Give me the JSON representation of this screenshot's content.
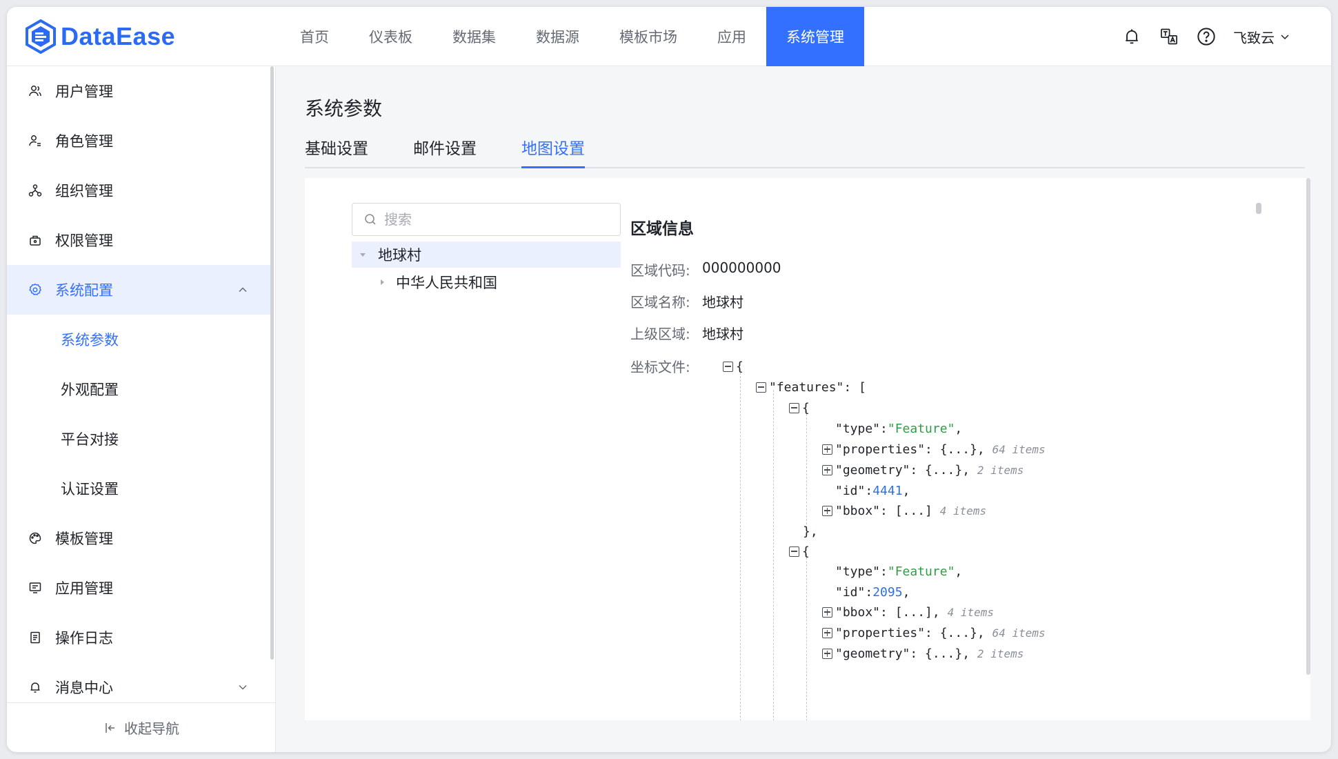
{
  "app": {
    "logo_text": "DataEase",
    "brand_color": "#3370ff"
  },
  "nav": {
    "items": [
      {
        "label": "首页"
      },
      {
        "label": "仪表板"
      },
      {
        "label": "数据集"
      },
      {
        "label": "数据源"
      },
      {
        "label": "模板市场"
      },
      {
        "label": "应用"
      },
      {
        "label": "系统管理"
      }
    ],
    "active": "系统管理"
  },
  "header": {
    "icons": [
      "bell-icon",
      "translate-icon",
      "help-circle-icon"
    ],
    "user_name": "飞致云"
  },
  "sidebar": {
    "items": [
      {
        "label": "用户管理",
        "icon": "user-icon"
      },
      {
        "label": "角色管理",
        "icon": "role-icon"
      },
      {
        "label": "组织管理",
        "icon": "org-icon"
      },
      {
        "label": "权限管理",
        "icon": "lock-icon"
      },
      {
        "label": "系统配置",
        "icon": "gear-icon"
      },
      {
        "label": "模板管理",
        "icon": "palette-icon"
      },
      {
        "label": "应用管理",
        "icon": "app-icon"
      },
      {
        "label": "操作日志",
        "icon": "log-icon"
      },
      {
        "label": "消息中心",
        "icon": "bell-icon"
      }
    ],
    "sub_items": [
      {
        "label": "系统参数"
      },
      {
        "label": "外观配置"
      },
      {
        "label": "平台对接"
      },
      {
        "label": "认证设置"
      }
    ],
    "active_sub": "系统参数",
    "collapse_label": "收起导航"
  },
  "main": {
    "title": "系统参数",
    "tabs": [
      {
        "label": "基础设置"
      },
      {
        "label": "邮件设置"
      },
      {
        "label": "地图设置"
      }
    ],
    "active_tab": "地图设置",
    "search": {
      "placeholder": "搜索",
      "value": ""
    },
    "tree": [
      {
        "label": "地球村",
        "expanded": true,
        "selected": true
      },
      {
        "label": "中华人民共和国",
        "expanded": false,
        "selected": false
      }
    ],
    "info": {
      "title": "区域信息",
      "code_label": "区域代码:",
      "code_value": "000000000",
      "name_label": "区域名称:",
      "name_value": "地球村",
      "parent_label": "上级区域:",
      "parent_value": "地球村",
      "file_label": "坐标文件:"
    },
    "json": {
      "open_brace": "{",
      "features_key": "\"features\"",
      "features_open": ": [",
      "f1": {
        "open": "{",
        "type_key": "\"type\"",
        "type_val": "\"Feature\"",
        "properties_key": "\"properties\"",
        "properties_collapsed": ": {...},",
        "properties_count": "64 items",
        "geometry_key": "\"geometry\"",
        "geometry_collapsed": ": {...},",
        "geometry_count": "2 items",
        "id_key": "\"id\"",
        "id_val": "4441",
        "bbox_key": "\"bbox\"",
        "bbox_collapsed": ": [...]",
        "bbox_count": "4 items",
        "close": "},"
      },
      "f2": {
        "open": "{",
        "type_key": "\"type\"",
        "type_val": "\"Feature\"",
        "id_key": "\"id\"",
        "id_val": "2095",
        "bbox_key": "\"bbox\"",
        "bbox_collapsed": ": [...],",
        "bbox_count": "4 items",
        "properties_key": "\"properties\"",
        "properties_collapsed": ": {...},",
        "properties_count": "64 items",
        "geometry_key": "\"geometry\"",
        "geometry_collapsed": ": {...},",
        "geometry_count": "2 items"
      }
    }
  }
}
